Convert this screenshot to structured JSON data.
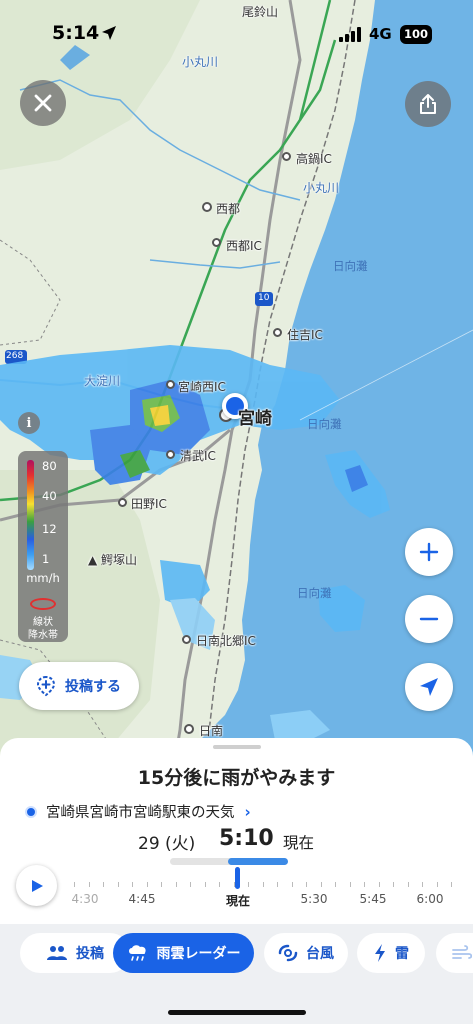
{
  "status_bar": {
    "time": "5:14",
    "network": "4G",
    "battery": "100"
  },
  "map": {
    "labels": {
      "mt_obasuzu": "尾鈴山",
      "komaru_river_top": "小丸川",
      "takanabe_ic": "高鍋IC",
      "komaru_river_east": "小丸川",
      "saito": "西都",
      "saito_ic": "西都IC",
      "hyuganada_north": "日向灘",
      "route_10": "10",
      "sumiyoshi_ic": "住吉IC",
      "route_268": "268",
      "oyodo_river": "大淀川",
      "miyazaki_nishi_ic": "宮崎西IC",
      "miyazaki": "宮崎",
      "hyuganada_mid": "日向灘",
      "kiyotake_ic": "清武IC",
      "tano_ic": "田野IC",
      "mt_wanitsuka": "鰐塚山",
      "hyuganada_south": "日向灘",
      "nichinan_kitago_ic": "日南北郷IC",
      "nichinan": "日南"
    },
    "legend": {
      "ticks": [
        "80",
        "40",
        "12",
        "1"
      ],
      "unit": "mm/h",
      "band_label_1": "線状",
      "band_label_2": "降水帯"
    },
    "post_button_label": "投稿する",
    "info_icon_text": "i"
  },
  "sheet": {
    "headline": "15分後に雨がやみます",
    "location": "宮崎県宮崎市宮崎駅東の天気",
    "date": "29 (火)",
    "time": "5:10",
    "now_label": "現在",
    "timeline_labels": [
      "4:30",
      "4:45",
      "現在",
      "5:30",
      "5:45",
      "6:00"
    ]
  },
  "tabs": {
    "post": "投稿",
    "radar": "雨雲レーダー",
    "typhoon": "台風",
    "thunder": "雷"
  },
  "colors": {
    "accent": "#1a63e6",
    "sea": "#6fb4e6",
    "land": "#e7eedf"
  }
}
